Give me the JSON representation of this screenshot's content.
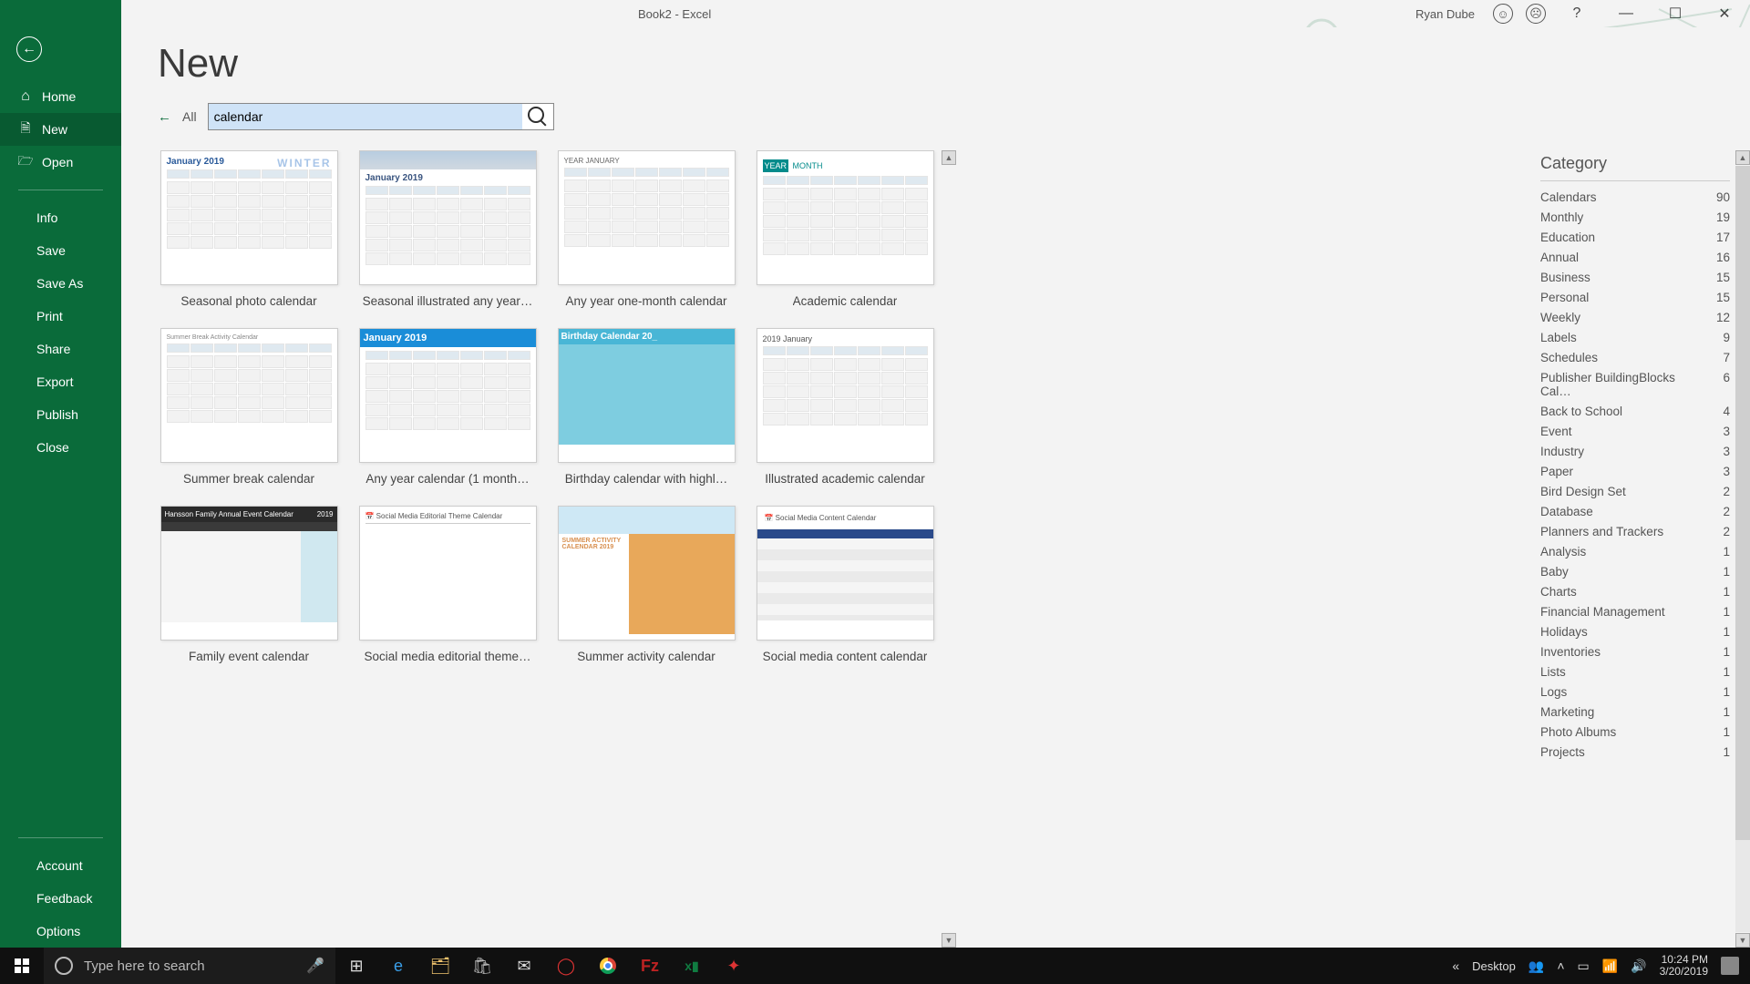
{
  "titlebar": {
    "title": "Book2  -  Excel",
    "user": "Ryan Dube",
    "help": "?"
  },
  "sidebar": {
    "home": "Home",
    "new": "New",
    "open": "Open",
    "items": [
      "Info",
      "Save",
      "Save As",
      "Print",
      "Share",
      "Export",
      "Publish",
      "Close"
    ],
    "bottom": [
      "Account",
      "Feedback",
      "Options"
    ]
  },
  "page": {
    "title": "New",
    "back_all": "All",
    "search_value": "calendar"
  },
  "templates": [
    {
      "label": "Seasonal photo calendar",
      "variant": "winter",
      "heading": "January 2019"
    },
    {
      "label": "Seasonal illustrated any year…",
      "variant": "illus",
      "heading": "January 2019"
    },
    {
      "label": "Any year one-month calendar",
      "variant": "plain",
      "heading": "YEAR   JANUARY"
    },
    {
      "label": "Academic calendar",
      "variant": "teal",
      "heading": "MONTH"
    },
    {
      "label": "Summer break calendar",
      "variant": "summer",
      "heading": "Summer Break Activity Calendar"
    },
    {
      "label": "Any year calendar (1 month…",
      "variant": "bluebar",
      "heading": "January 2019"
    },
    {
      "label": "Birthday calendar with highl…",
      "variant": "birthday",
      "heading": "Birthday Calendar           20_"
    },
    {
      "label": "Illustrated academic calendar",
      "variant": "illacad",
      "heading": "2019  January"
    },
    {
      "label": "Family event calendar",
      "variant": "family",
      "heading": "Hansson Family Annual Event Calendar"
    },
    {
      "label": "Social media editorial theme…",
      "variant": "sme",
      "heading": "Social Media Editorial Theme Calendar"
    },
    {
      "label": "Summer activity calendar",
      "variant": "sumact",
      "heading": "SUMMER ACTIVITY CALENDAR 2019"
    },
    {
      "label": "Social media content calendar",
      "variant": "smc",
      "heading": "Social Media Content Calendar"
    }
  ],
  "category": {
    "title": "Category",
    "items": [
      {
        "name": "Calendars",
        "count": 90
      },
      {
        "name": "Monthly",
        "count": 19
      },
      {
        "name": "Education",
        "count": 17
      },
      {
        "name": "Annual",
        "count": 16
      },
      {
        "name": "Business",
        "count": 15
      },
      {
        "name": "Personal",
        "count": 15
      },
      {
        "name": "Weekly",
        "count": 12
      },
      {
        "name": "Labels",
        "count": 9
      },
      {
        "name": "Schedules",
        "count": 7
      },
      {
        "name": "Publisher BuildingBlocks Cal…",
        "count": 6
      },
      {
        "name": "Back to School",
        "count": 4
      },
      {
        "name": "Event",
        "count": 3
      },
      {
        "name": "Industry",
        "count": 3
      },
      {
        "name": "Paper",
        "count": 3
      },
      {
        "name": "Bird Design Set",
        "count": 2
      },
      {
        "name": "Database",
        "count": 2
      },
      {
        "name": "Planners and Trackers",
        "count": 2
      },
      {
        "name": "Analysis",
        "count": 1
      },
      {
        "name": "Baby",
        "count": 1
      },
      {
        "name": "Charts",
        "count": 1
      },
      {
        "name": "Financial Management",
        "count": 1
      },
      {
        "name": "Holidays",
        "count": 1
      },
      {
        "name": "Inventories",
        "count": 1
      },
      {
        "name": "Lists",
        "count": 1
      },
      {
        "name": "Logs",
        "count": 1
      },
      {
        "name": "Marketing",
        "count": 1
      },
      {
        "name": "Photo Albums",
        "count": 1
      },
      {
        "name": "Projects",
        "count": 1
      }
    ]
  },
  "taskbar": {
    "search_placeholder": "Type here to search",
    "desktop": "Desktop",
    "time": "10:24 PM",
    "date": "3/20/2019"
  }
}
